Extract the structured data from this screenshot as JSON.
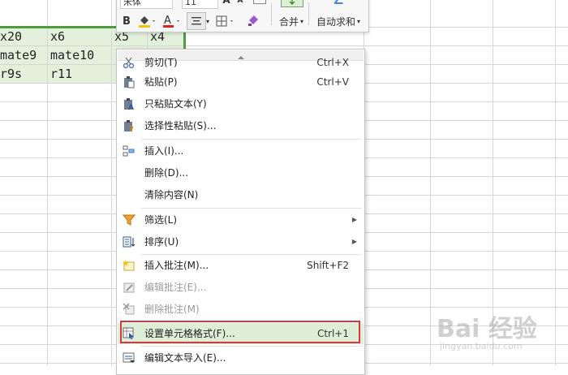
{
  "sheet": {
    "rows": [
      [
        "x20",
        "x6",
        "x5",
        "x4"
      ],
      [
        "mate9",
        "mate10",
        "",
        ""
      ],
      [
        "r9s",
        "r11",
        "",
        ""
      ]
    ]
  },
  "toolbar": {
    "font_name": "宋体",
    "font_size": "11",
    "bold": "B",
    "font_color_letter": "A",
    "merge_label": "合并",
    "autosum_label": "自动求和",
    "sigma": "Σ"
  },
  "menu": {
    "items": [
      {
        "label": "剪切(T)",
        "shortcut": "Ctrl+X",
        "icon": "scissors-icon"
      },
      {
        "label": "粘贴(P)",
        "shortcut": "Ctrl+V",
        "icon": "paste-icon"
      },
      {
        "label": "只粘贴文本(Y)",
        "shortcut": "",
        "icon": "paste-text-icon"
      },
      {
        "label": "选择性粘贴(S)...",
        "shortcut": "",
        "icon": "paste-special-icon"
      },
      {
        "label": "插入(I)...",
        "shortcut": "",
        "icon": "insert-icon"
      },
      {
        "label": "删除(D)...",
        "shortcut": "",
        "icon": ""
      },
      {
        "label": "清除内容(N)",
        "shortcut": "",
        "icon": ""
      },
      {
        "label": "筛选(L)",
        "shortcut": "",
        "icon": "filter-icon"
      },
      {
        "label": "排序(U)",
        "shortcut": "",
        "icon": "sort-icon"
      },
      {
        "label": "插入批注(M)...",
        "shortcut": "Shift+F2",
        "icon": "insert-comment-icon"
      },
      {
        "label": "编辑批注(E)...",
        "shortcut": "",
        "icon": "edit-comment-icon"
      },
      {
        "label": "删除批注(M)",
        "shortcut": "",
        "icon": "delete-comment-icon"
      },
      {
        "label": "设置单元格格式(F)...",
        "shortcut": "Ctrl+1",
        "icon": "format-cells-icon"
      },
      {
        "label": "编辑文本导入(E)...",
        "shortcut": "",
        "icon": "text-import-icon"
      }
    ]
  },
  "watermark": {
    "main": "Bai 经验",
    "sub": "jingyan.baidu.com"
  }
}
